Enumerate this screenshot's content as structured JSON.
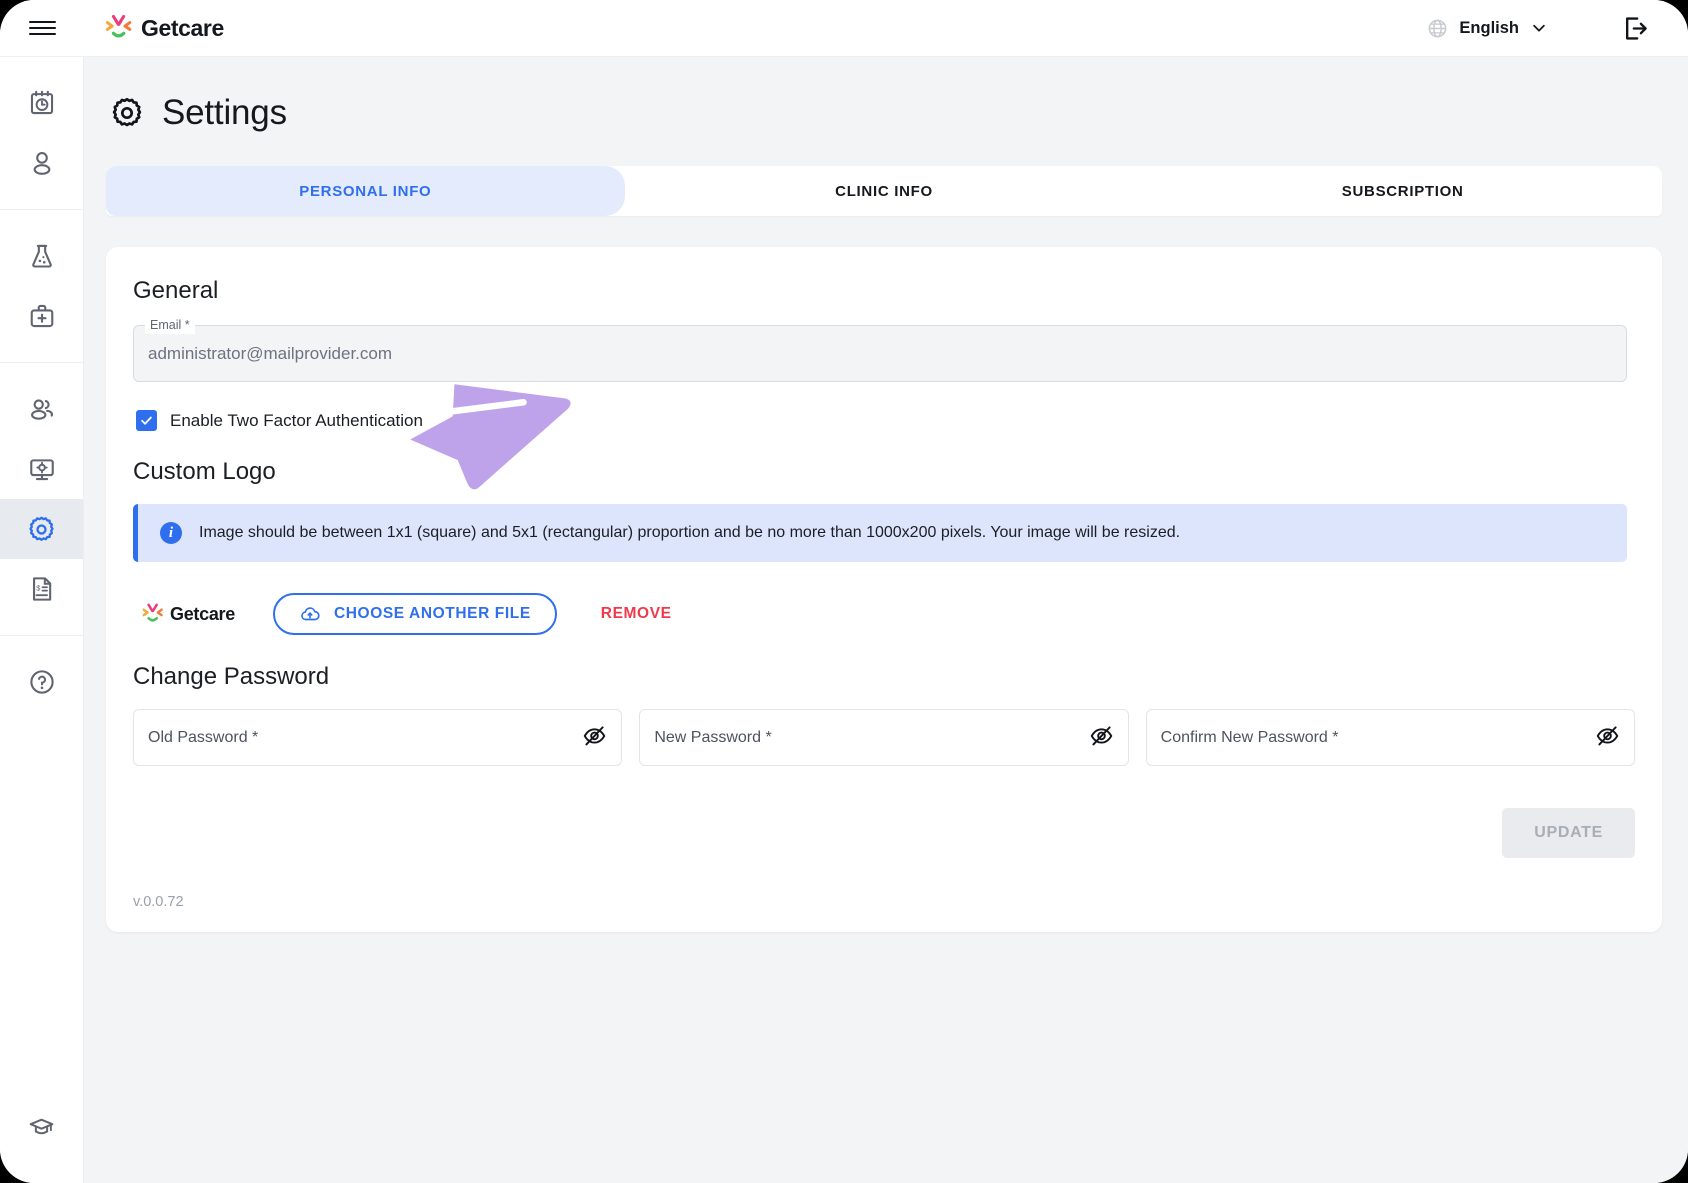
{
  "app": {
    "brand_name": "Getcare",
    "version": "v.0.0.72"
  },
  "topbar": {
    "menu_icon": "hamburger-menu-icon",
    "logo_icon": "getcare-logo-icon",
    "language_icon": "globe-icon",
    "language_label": "English",
    "language_caret": "chevron-down-icon",
    "logout_icon": "logout-icon"
  },
  "sidebar": {
    "groups": [
      {
        "items": [
          {
            "name": "sidebar-item-appointments",
            "icon": "calendar-clock-icon",
            "active": false
          },
          {
            "name": "sidebar-item-patients",
            "icon": "user-icon",
            "active": false
          }
        ]
      },
      {
        "items": [
          {
            "name": "sidebar-item-lab",
            "icon": "lab-flask-icon",
            "active": false
          },
          {
            "name": "sidebar-item-medical-kit",
            "icon": "medical-briefcase-icon",
            "active": false
          }
        ]
      },
      {
        "items": [
          {
            "name": "sidebar-item-staff",
            "icon": "users-group-icon",
            "active": false
          },
          {
            "name": "sidebar-item-devices",
            "icon": "monitor-gear-icon",
            "active": false
          },
          {
            "name": "sidebar-item-settings",
            "icon": "gear-icon",
            "active": true
          },
          {
            "name": "sidebar-item-invoices",
            "icon": "invoice-document-icon",
            "active": false
          }
        ]
      },
      {
        "items": [
          {
            "name": "sidebar-item-help",
            "icon": "question-circle-icon",
            "active": false
          }
        ]
      }
    ],
    "bottom": {
      "name": "sidebar-item-training",
      "icon": "graduation-cap-icon"
    }
  },
  "page": {
    "title": "Settings",
    "title_icon": "gear-icon"
  },
  "tabs": [
    {
      "label": "PERSONAL INFO",
      "active": true
    },
    {
      "label": "CLINIC INFO",
      "active": false
    },
    {
      "label": "SUBSCRIPTION",
      "active": false
    }
  ],
  "general": {
    "heading": "General",
    "email": {
      "label": "Email *",
      "value": "administrator@mailprovider.com"
    },
    "two_factor": {
      "label": "Enable Two Factor Authentication",
      "checked": true,
      "check_icon": "checkmark-icon"
    }
  },
  "custom_logo": {
    "heading": "Custom Logo",
    "banner": {
      "icon": "info-icon",
      "icon_glyph": "i",
      "text": "Image should be between 1x1 (square) and 5x1 (rectangular) proportion and be no more than 1000x200 pixels. Your image will be resized."
    },
    "preview_logo": "getcare-logo-icon",
    "preview_name": "Getcare",
    "choose_button": {
      "label": "CHOOSE ANOTHER FILE",
      "icon": "cloud-upload-icon"
    },
    "remove_button": {
      "label": "REMOVE"
    }
  },
  "change_password": {
    "heading": "Change Password",
    "fields": [
      {
        "name": "old-password-field",
        "placeholder": "Old Password *",
        "value": "",
        "eye_icon": "eye-off-icon"
      },
      {
        "name": "new-password-field",
        "placeholder": "New Password *",
        "value": "",
        "eye_icon": "eye-off-icon"
      },
      {
        "name": "confirm-password-field",
        "placeholder": "Confirm New Password *",
        "value": "",
        "eye_icon": "eye-off-icon"
      }
    ],
    "submit": {
      "label": "UPDATE",
      "disabled": true
    }
  },
  "annotation": {
    "shape": "purple-arrow-pointing-right",
    "color": "#b79ae8"
  },
  "colors": {
    "accent_blue": "#2f6fed",
    "tab_active_bg": "#e4ebfd",
    "banner_bg": "#dde5fd",
    "danger_red": "#ef3a4c",
    "page_bg": "#f3f4f6",
    "annotation_purple": "#b79ae8"
  }
}
